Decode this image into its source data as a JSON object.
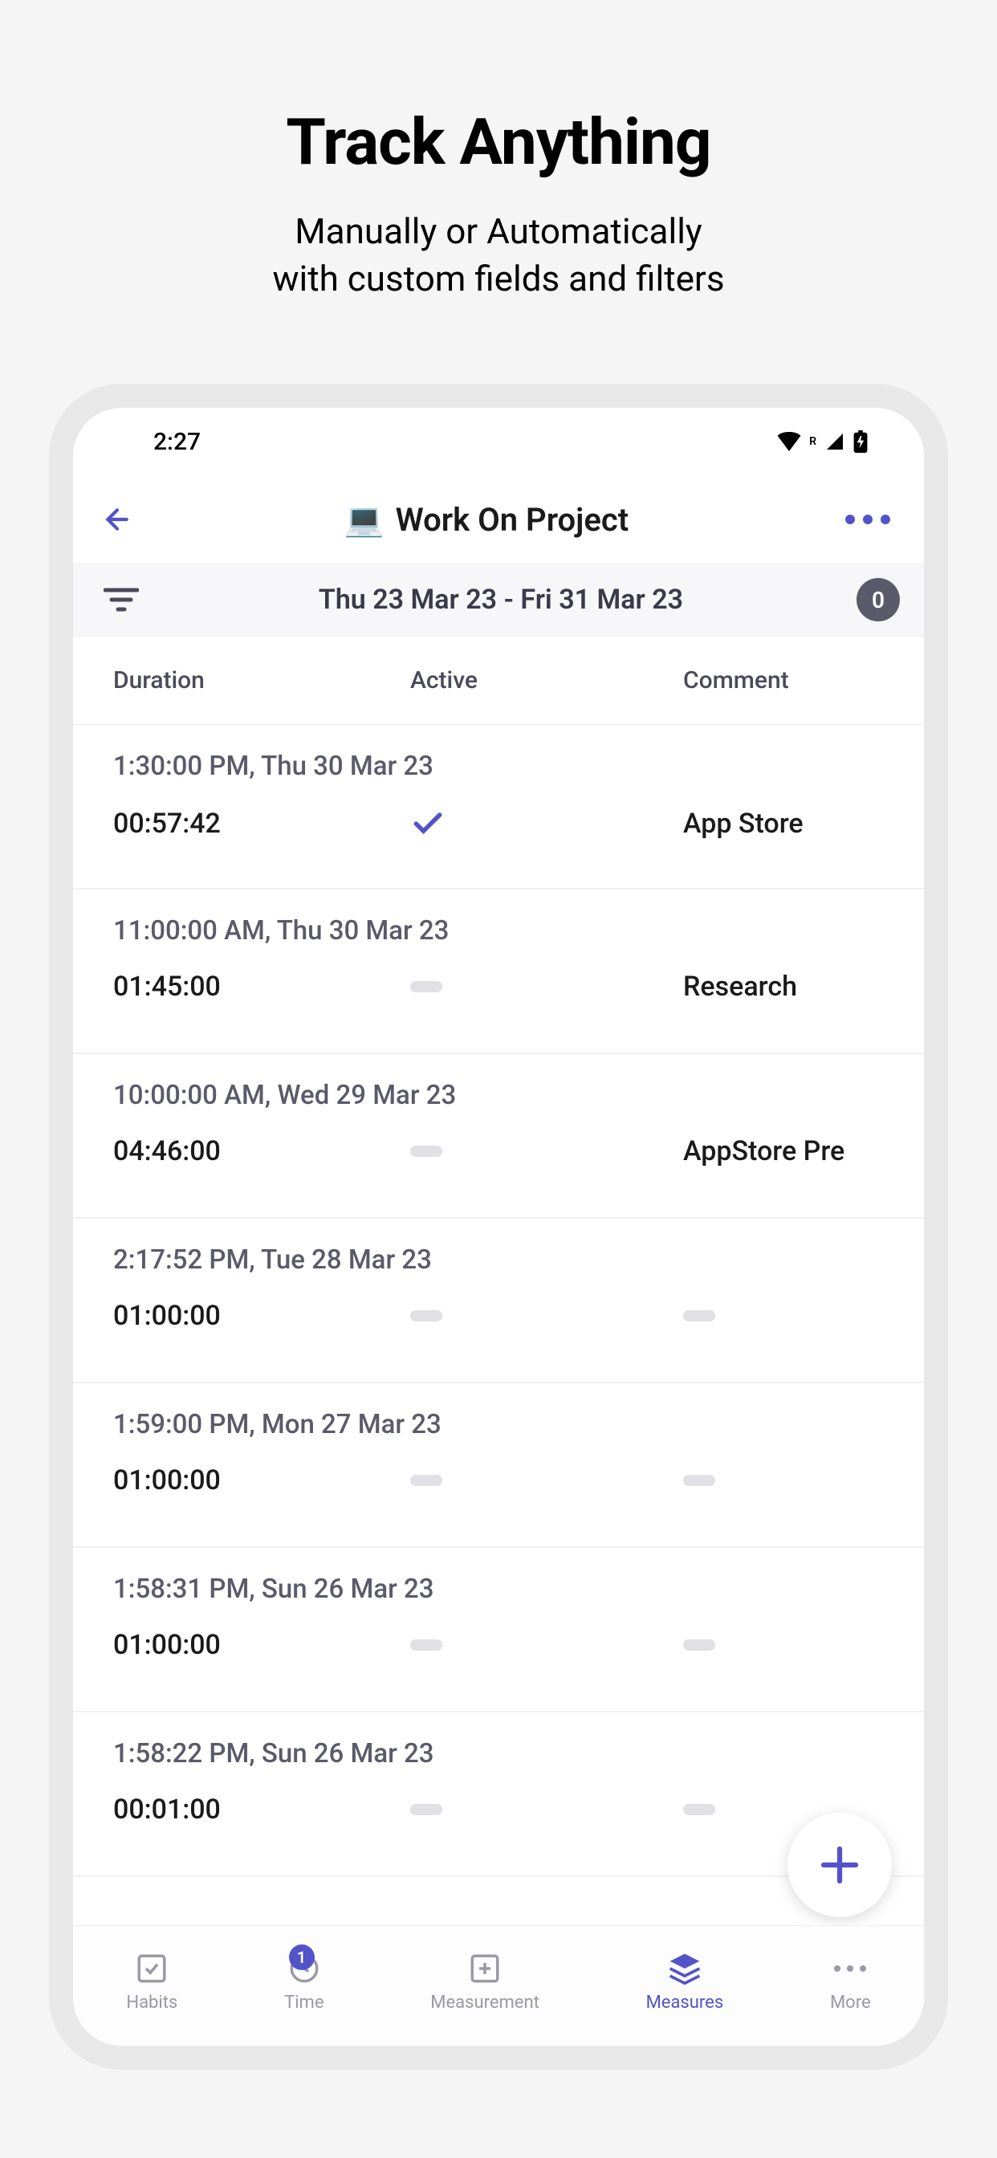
{
  "promo": {
    "title": "Track Anything",
    "subtitle_line1": "Manually or Automatically",
    "subtitle_line2": "with custom fields and filters"
  },
  "status": {
    "time": "2:27"
  },
  "header": {
    "icon": "💻",
    "title": "Work On Project"
  },
  "filter": {
    "date_range": "Thu 23 Mar 23 - Fri 31 Mar 23",
    "count": "0"
  },
  "columns": {
    "duration": "Duration",
    "active": "Active",
    "comment": "Comment"
  },
  "entries": [
    {
      "timestamp": "1:30:00 PM, Thu 30 Mar 23",
      "duration": "00:57:42",
      "active": true,
      "comment": "App Store"
    },
    {
      "timestamp": "11:00:00 AM, Thu 30 Mar 23",
      "duration": "01:45:00",
      "active": false,
      "comment": "Research"
    },
    {
      "timestamp": "10:00:00 AM, Wed 29 Mar 23",
      "duration": "04:46:00",
      "active": false,
      "comment": "AppStore Pre"
    },
    {
      "timestamp": "2:17:52 PM, Tue 28 Mar 23",
      "duration": "01:00:00",
      "active": false,
      "comment": ""
    },
    {
      "timestamp": "1:59:00 PM, Mon 27 Mar 23",
      "duration": "01:00:00",
      "active": false,
      "comment": ""
    },
    {
      "timestamp": "1:58:31 PM, Sun 26 Mar 23",
      "duration": "01:00:00",
      "active": false,
      "comment": ""
    },
    {
      "timestamp": "1:58:22 PM, Sun 26 Mar 23",
      "duration": "00:01:00",
      "active": false,
      "comment": ""
    }
  ],
  "nav": {
    "habits": "Habits",
    "time": "Time",
    "time_badge": "1",
    "measurement": "Measurement",
    "measures": "Measures",
    "more": "More"
  }
}
